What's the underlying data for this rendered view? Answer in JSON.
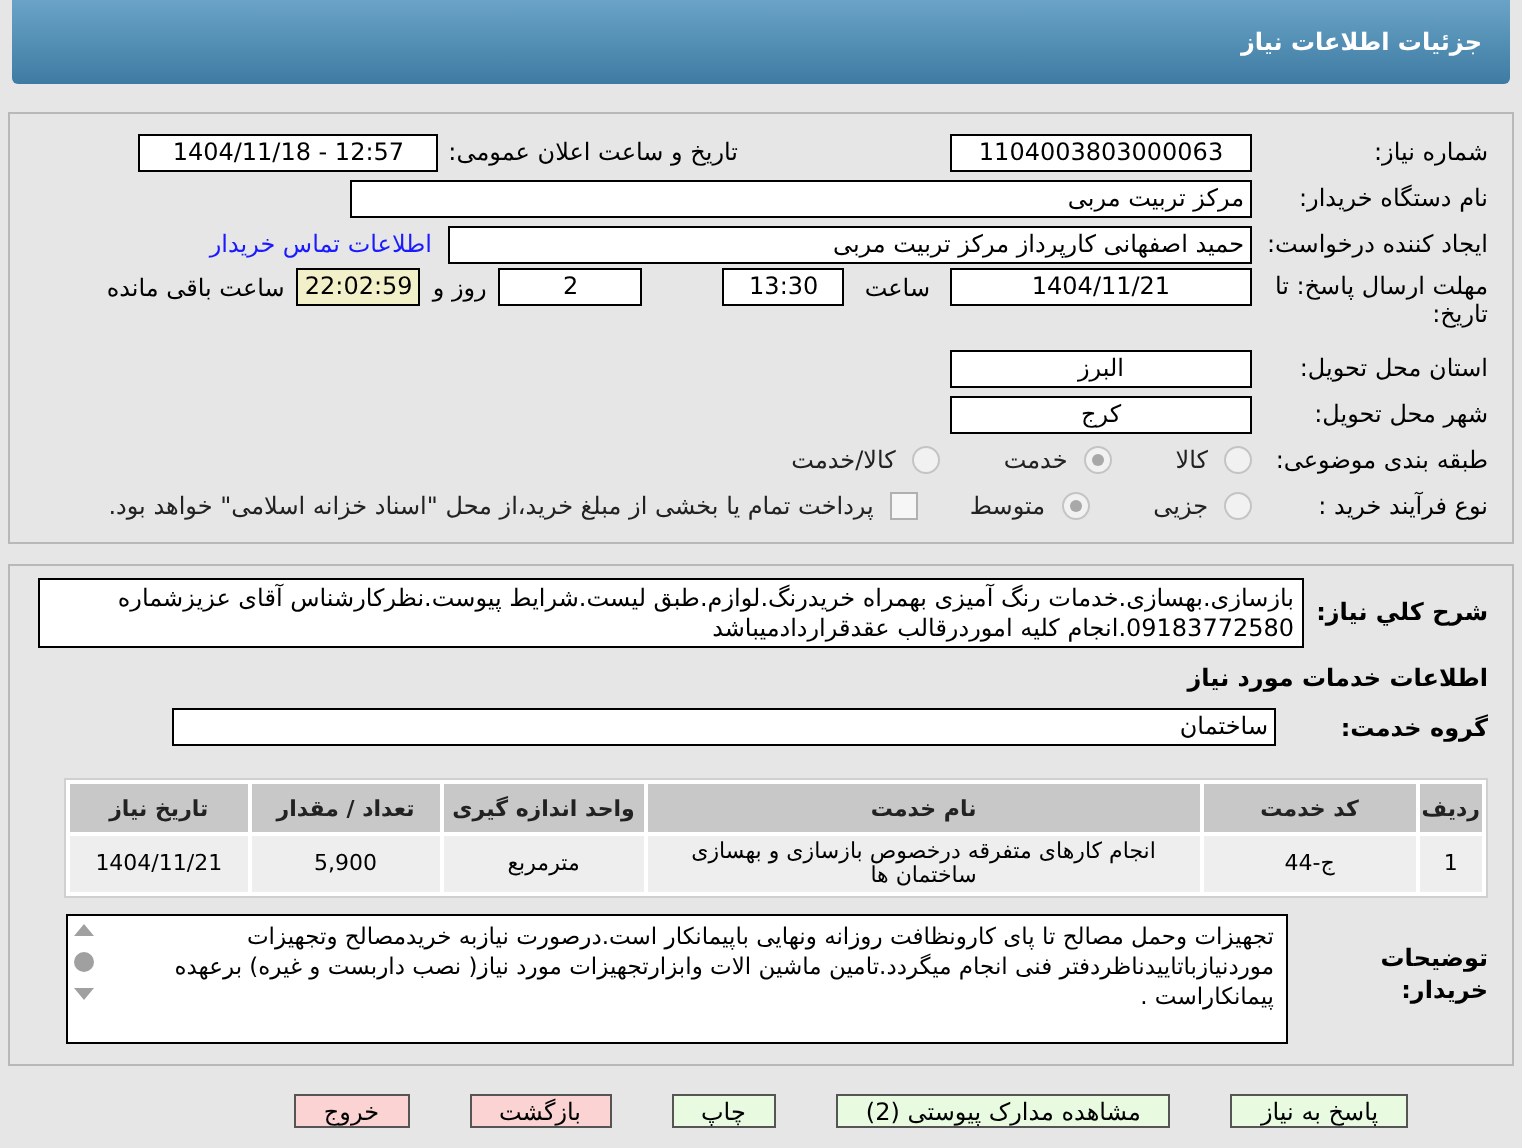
{
  "header": {
    "title": "جزئیات اطلاعات نیاز"
  },
  "details": {
    "need_number": {
      "label": "شماره نیاز:",
      "value": "1104003803000063"
    },
    "announce": {
      "label": "تاریخ و ساعت اعلان عمومی:",
      "value": "1404/11/18 - 12:57"
    },
    "buyer": {
      "label": "نام دستگاه خریدار:",
      "value": "مرکز تربیت مربی"
    },
    "creator": {
      "label": "ایجاد کننده درخواست:",
      "value": "حمید اصفهانی کارپرداز مرکز تربیت مربی",
      "link": "اطلاعات تماس خریدار"
    },
    "deadline": {
      "label": "مهلت ارسال پاسخ: تا تاریخ:",
      "date": "1404/11/21",
      "time_label": "ساعت",
      "time": "13:30",
      "days": "2",
      "days_label": "روز و",
      "remaining": "22:02:59",
      "remaining_label": "ساعت باقی مانده"
    },
    "province": {
      "label": "استان محل تحویل:",
      "value": "البرز"
    },
    "city": {
      "label": "شهر محل تحویل:",
      "value": "کرج"
    },
    "category": {
      "label": "طبقه بندی موضوعی:",
      "options": [
        {
          "label": "کالا",
          "selected": false
        },
        {
          "label": "خدمت",
          "selected": true
        },
        {
          "label": "کالا/خدمت",
          "selected": false
        }
      ]
    },
    "process": {
      "label": "نوع فرآیند خرید :",
      "options": [
        {
          "label": "جزیی",
          "selected": false
        },
        {
          "label": "متوسط",
          "selected": true
        }
      ],
      "payment": {
        "label": "پرداخت تمام یا بخشی از مبلغ خرید،از محل \"اسناد خزانه اسلامی\" خواهد بود.",
        "checked": false
      }
    }
  },
  "needs": {
    "summary": {
      "label": "شرح کلي نیاز:",
      "value": "بازسازی.بهسازی.خدمات رنگ آمیزی بهمراه خریدرنگ.لوازم.طبق لیست.شرایط پیوست.نظرکارشناس آقای عزیزشماره 09183772580.انجام کلیه اموردرقالب عقدقراردادمیباشد"
    },
    "section_title": "اطلاعات خدمات مورد نیاز",
    "group": {
      "label": "گروه خدمت:",
      "value": "ساختمان"
    },
    "table": {
      "columns": [
        "ردیف",
        "کد خدمت",
        "نام خدمت",
        "واحد اندازه گیری",
        "تعداد / مقدار",
        "تاریخ نیاز"
      ],
      "rows": [
        [
          "1",
          "ج-44",
          "انجام کارهای متفرقه درخصوص بازسازی و بهسازی ساختمان ها",
          "مترمربع",
          "5,900",
          "1404/11/21"
        ]
      ]
    },
    "notes": {
      "label": "توضیحات خریدار:",
      "value": "تجهیزات وحمل مصالح  تا پای کارونظافت روزانه ونهایی باپیمانکار است.درصورت نیازبه خریدمصالح وتجهیزات موردنیازباتاییدناظردفتر فنی انجام میگردد.تامین ماشین الات وابزارتجهیزات مورد نیاز( نصب  داربست و غیره) برعهده پیمانکاراست ."
    }
  },
  "buttons": [
    {
      "label": "پاسخ به نیاز",
      "kind": "primary"
    },
    {
      "label": "مشاهده مدارک پیوستی (2)",
      "kind": "primary"
    },
    {
      "label": "چاپ",
      "kind": "primary"
    },
    {
      "label": "بازگشت",
      "kind": "danger"
    },
    {
      "label": "خروج",
      "kind": "danger"
    }
  ]
}
